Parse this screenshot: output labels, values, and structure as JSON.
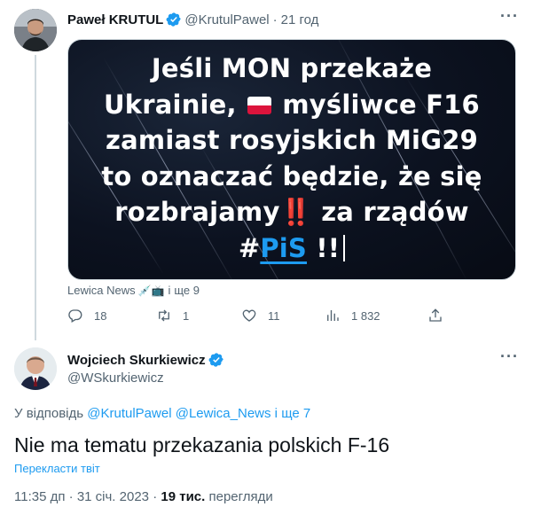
{
  "tweet1": {
    "author_name": "Paweł KRUTUL",
    "handle": "@KrutulPawel",
    "separator": "·",
    "time": "21 год",
    "more": "···",
    "image_text": {
      "line1": "Jeśli MON przekaże",
      "line2_a": "Ukrainie,",
      "line2_b": "myśliwce F16",
      "line3": "zamiast  rosyjskich MiG29",
      "line4": "to oznaczać będzie, że się",
      "line5_a": "rozbrajamy",
      "line5_bang": "‼️",
      "line5_b": "za rządów",
      "line6_hash": "#",
      "line6_pis": "PiS",
      "line6_end": "!!"
    },
    "tags": {
      "account": "Lewica News",
      "emoji": "💉📺",
      "separator": "і",
      "others": "ще 9"
    },
    "actions": {
      "replies": "18",
      "retweets": "1",
      "likes": "11",
      "views": "1 832"
    }
  },
  "tweet2": {
    "author_name": "Wojciech Skurkiewicz",
    "handle": "@WSkurkiewicz",
    "more": "···",
    "reply_to": {
      "prefix": "У відповідь",
      "user1": "@KrutulPawel",
      "user2": "@Lewica_News",
      "and": "і",
      "others": "ще 7"
    },
    "text": "Nie ma tematu przekazania polskich F-16",
    "translate": "Перекласти твіт",
    "time": "11:35 дп",
    "separator": "·",
    "date": "31 січ. 2023",
    "views_count": "19 тис.",
    "views_label": "перегляди"
  },
  "colors": {
    "accent": "#1d9bf0",
    "secondary_text": "#536471",
    "primary_text": "#0f1419",
    "thread_line": "#cfd9de",
    "flag_red": "#dc143c",
    "exclamation_red": "#e0191f"
  },
  "icons": {
    "verified": "verified-badge-icon",
    "reply": "reply-icon",
    "retweet": "retweet-icon",
    "like": "heart-icon",
    "views": "views-chart-icon",
    "share": "share-icon"
  }
}
